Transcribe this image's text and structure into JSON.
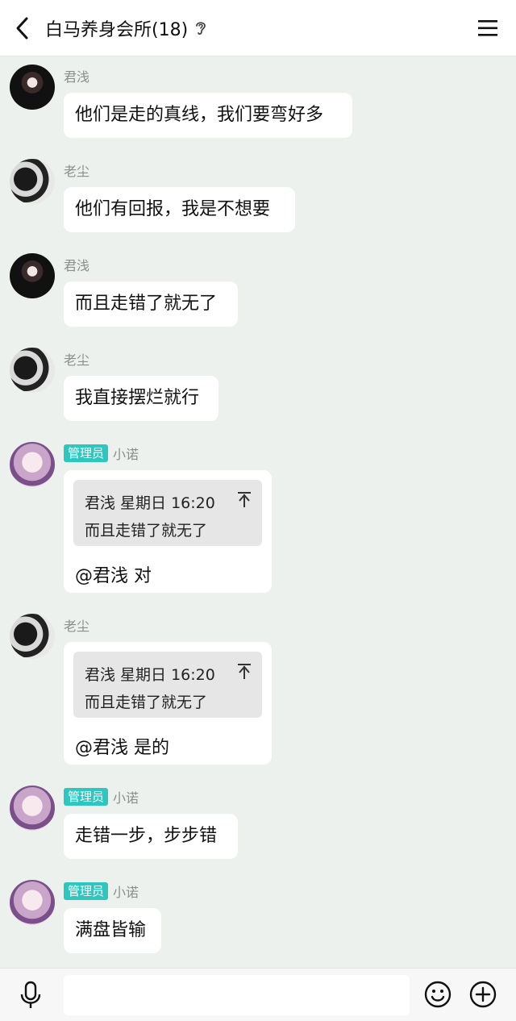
{
  "header": {
    "title": "白马养身会所(18)",
    "back_icon": "chevron-left-icon",
    "ear_icon": "ear-icon",
    "menu_icon": "hamburger-menu-icon"
  },
  "colors": {
    "background": "#edf1ee",
    "bubble": "#ffffff",
    "admin_badge": "#2ec7c0",
    "quote_box": "#e6e6e6"
  },
  "messages": [
    {
      "sender": "君浅",
      "text": "他们是走的真线，我们要弯好多"
    },
    {
      "sender": "老尘",
      "text": "他们有回报，我是不想要"
    },
    {
      "sender": "君浅",
      "text": "而且走错了就无了"
    },
    {
      "sender": "老尘",
      "text": "我直接摆烂就行"
    },
    {
      "badge": "管理员",
      "sender": "小诺",
      "quote": {
        "header": "君浅 星期日 16:20",
        "text": "而且走错了就无了"
      },
      "text": "@君浅 对"
    },
    {
      "sender": "老尘",
      "quote": {
        "header": "君浅 星期日 16:20",
        "text": "而且走错了就无了"
      },
      "text": "@君浅 是的"
    },
    {
      "badge": "管理员",
      "sender": "小诺",
      "text": "走错一步，步步错"
    },
    {
      "badge": "管理员",
      "sender": "小诺",
      "text": "满盘皆输"
    }
  ],
  "input_bar": {
    "mic_icon": "microphone-icon",
    "input_value": "",
    "emoji_icon": "emoji-smile-icon",
    "plus_icon": "plus-circle-icon"
  }
}
